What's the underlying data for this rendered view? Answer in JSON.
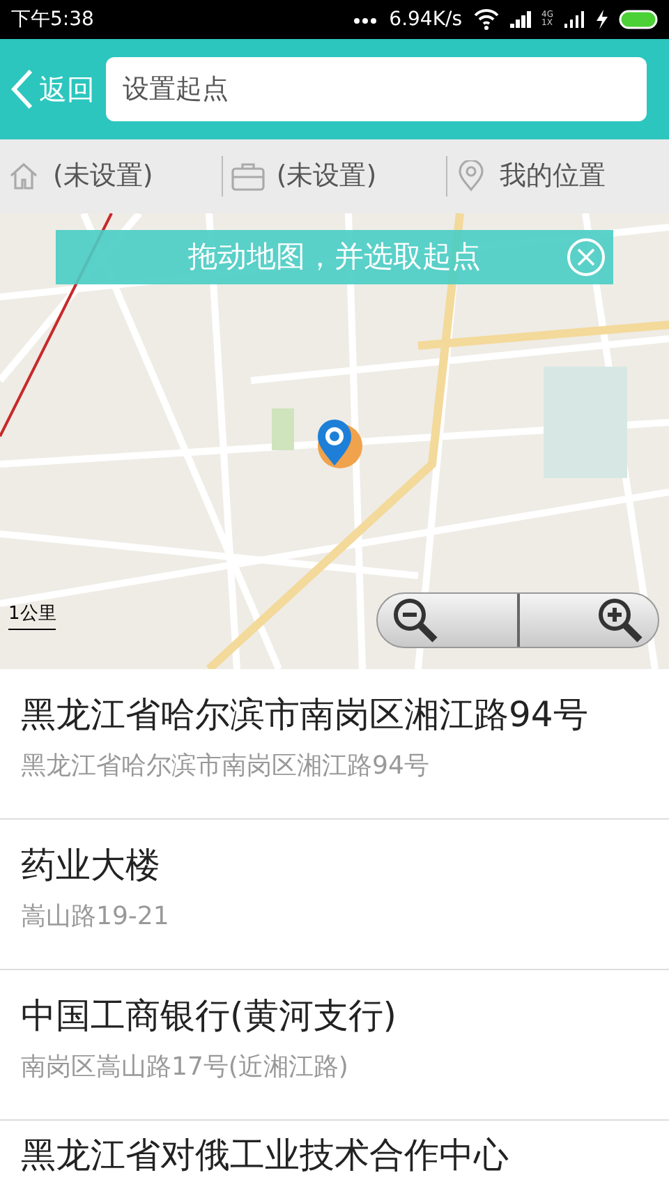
{
  "status_bar": {
    "time": "下午5:38",
    "speed": "6.94K/s",
    "network_labels": [
      "4G",
      "1X"
    ]
  },
  "header": {
    "back_label": "返回",
    "search": {
      "placeholder": "设置起点"
    }
  },
  "shortcuts": [
    {
      "kind": "home",
      "label": "(未设置)"
    },
    {
      "kind": "work",
      "label": "(未设置)"
    },
    {
      "kind": "location",
      "label": "我的位置"
    }
  ],
  "map": {
    "hint": "拖动地图，并选取起点",
    "scale": "1公里"
  },
  "results": [
    {
      "title": "黑龙江省哈尔滨市南岗区湘江路94号",
      "address": "黑龙江省哈尔滨市南岗区湘江路94号"
    },
    {
      "title": "药业大楼",
      "address": "嵩山路19-21"
    },
    {
      "title": "中国工商银行(黄河支行)",
      "address": "南岗区嵩山路17号(近湘江路)"
    },
    {
      "title": "黑龙江省对俄工业技术合作中心"
    }
  ]
}
